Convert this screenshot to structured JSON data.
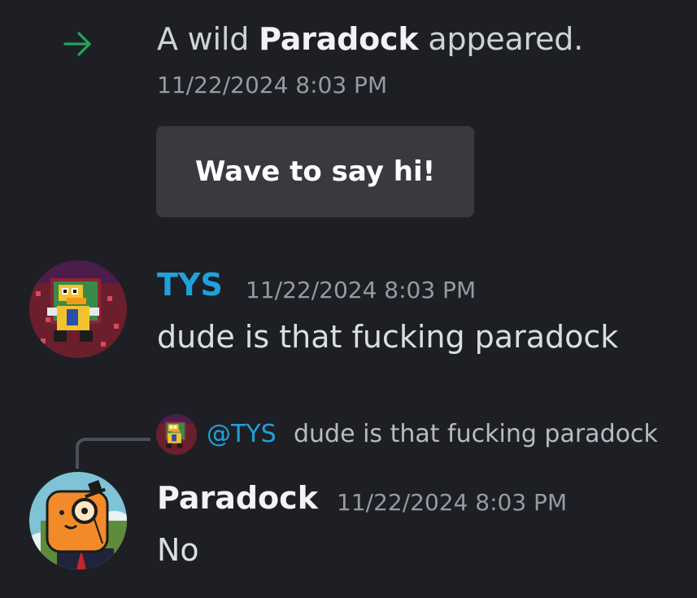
{
  "system_message": {
    "prefix": "A wild ",
    "username": "Paradock",
    "suffix": " appeared.",
    "timestamp": "11/22/2024 8:03 PM",
    "wave_button_label": "Wave to say hi!",
    "arrow_color": "#23a55a",
    "arrow_icon": "join-arrow-icon"
  },
  "messages": [
    {
      "author": "TYS",
      "author_color": "#1fa1db",
      "timestamp": "11/22/2024 8:03 PM",
      "content": "dude is that fucking paradock",
      "avatar": "pixel-duck-avatar"
    },
    {
      "author": "Paradock",
      "author_color": "#f2f3f5",
      "timestamp": "11/22/2024 8:03 PM",
      "content": "No",
      "avatar": "orange-monocle-bot-avatar",
      "reply": {
        "mention": "@TYS",
        "text": "dude is that fucking paradock"
      }
    }
  ],
  "colors": {
    "background": "#1e1f24",
    "button_bg": "#383a40",
    "timestamp": "#989aa2",
    "text": "#dbdee1"
  }
}
